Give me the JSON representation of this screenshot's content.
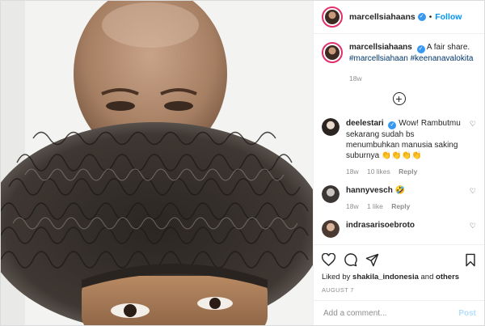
{
  "post_image": {
    "alt": ""
  },
  "header": {
    "username": "marcellsiahaans",
    "separator": "•",
    "follow_label": "Follow",
    "more_icon": "more-horizontal-icon"
  },
  "caption": {
    "username": "marcellsiahaans",
    "text": "A fair share.",
    "hashtags": "#marcellsiahaan #keenanavalokita",
    "age": "18w"
  },
  "load_more_icon": "plus-circle-icon",
  "comments": [
    {
      "username": "deelestari",
      "text": "Wow! Rambutmu sekarang sudah bs menumbuhkan manusia saking suburnya 👏👏👏👏",
      "age": "18w",
      "likes": "10 likes",
      "reply": "Reply"
    },
    {
      "username": "hannyvesch",
      "text": "🤣",
      "age": "18w",
      "likes": "1 like",
      "reply": "Reply"
    },
    {
      "username": "indrasarisoebroto",
      "text": "",
      "age": "",
      "likes": "",
      "reply": ""
    }
  ],
  "actions": {
    "liked_by_prefix": "Liked by ",
    "liked_by_user": "shakila_indonesia",
    "liked_by_and": " and ",
    "liked_by_others": "others",
    "date": "AUGUST 7"
  },
  "composer": {
    "placeholder": "Add a comment...",
    "post_label": "Post"
  },
  "colors": {
    "accent": "#0095f6",
    "verified": "#3897f0",
    "muted": "#8e8e8e",
    "text": "#262626"
  }
}
